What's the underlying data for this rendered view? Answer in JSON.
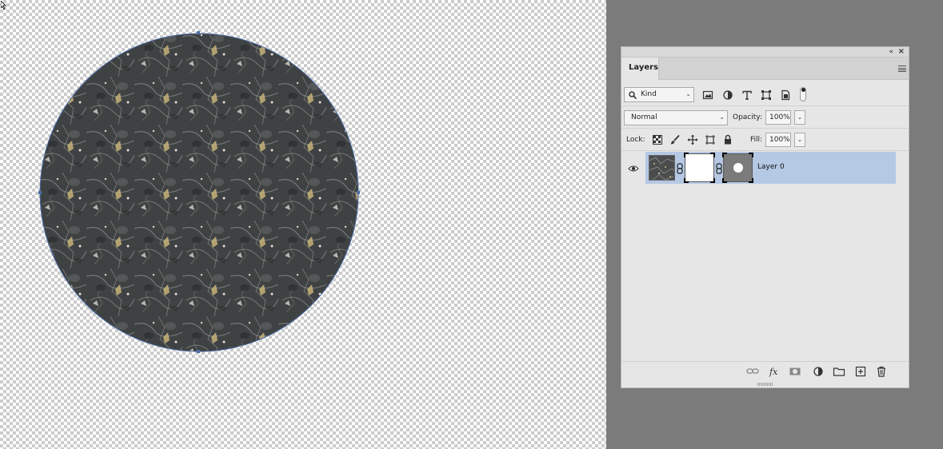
{
  "panel": {
    "tab_label": "Layers",
    "collapse_glyph": "«",
    "close_glyph": "×"
  },
  "filter": {
    "kind_value": "Kind",
    "icons": [
      "image-filter-icon",
      "adjustment-filter-icon",
      "type-filter-icon",
      "shape-filter-icon",
      "smart-object-filter-icon"
    ]
  },
  "blend": {
    "mode": "Normal",
    "opacity_label": "Opacity:",
    "opacity_value": "100%"
  },
  "lock": {
    "label": "Lock:",
    "fill_label": "Fill:",
    "fill_value": "100%",
    "icons": [
      "lock-transparent-icon",
      "lock-image-icon",
      "lock-position-icon",
      "lock-artboard-icon",
      "lock-all-icon"
    ]
  },
  "layers": [
    {
      "name": "Layer 0",
      "visible": true,
      "selected": true
    }
  ],
  "footer_icons": [
    "link-layers-icon",
    "fx-icon",
    "add-mask-icon",
    "new-fill-adjustment-icon",
    "new-group-icon",
    "new-layer-icon",
    "delete-layer-icon"
  ],
  "colors": {
    "selection": "#b5c8e4",
    "workspace": "#7b7b7b",
    "panel": "#e6e6e6"
  }
}
